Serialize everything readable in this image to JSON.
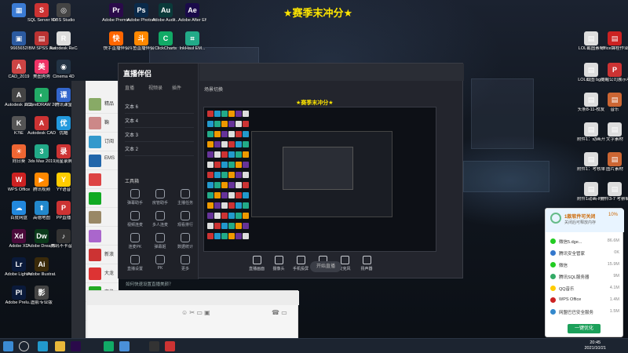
{
  "banner": "★赛季末冲分★",
  "desktop_icons": [
    {
      "label": "",
      "color": "#3b7bd4",
      "glyph": "▦"
    },
    {
      "label": "SQL Server Manage...",
      "color": "#c33",
      "glyph": "S"
    },
    {
      "label": "OBS Studio",
      "color": "#444",
      "glyph": "◎"
    },
    {
      "label": "Adobe Premie...",
      "color": "#2a0a4a",
      "glyph": "Pr"
    },
    {
      "label": "Adobe Photosh...",
      "color": "#0a2a4a",
      "glyph": "Ps"
    },
    {
      "label": "Adobe Audit...",
      "color": "#0a3a3a",
      "glyph": "Au"
    },
    {
      "label": "Adobe After Effects CC ...",
      "color": "#1a0a4a",
      "glyph": "Ae"
    },
    {
      "label": "9665652",
      "color": "#2b5aa0",
      "glyph": "▣"
    },
    {
      "label": "IBM SPSS Statistics 21",
      "color": "#b33",
      "glyph": "▤"
    },
    {
      "label": "Autodesk ReCap",
      "color": "#ddd",
      "glyph": "R"
    },
    {
      "label": "快手直播伴侣",
      "color": "#f60",
      "glyph": "快"
    },
    {
      "label": "斗鱼直播伴侣",
      "color": "#f80",
      "glyph": "斗"
    },
    {
      "label": "ClickCharts",
      "color": "#1a6",
      "glyph": "C"
    },
    {
      "label": "InkHaul EM...",
      "color": "#2a8",
      "glyph": "⌗"
    },
    {
      "label": "CAD_2019",
      "color": "#c44",
      "glyph": "A"
    },
    {
      "label": "美图秀秀",
      "color": "#e36",
      "glyph": "美"
    },
    {
      "label": "Cinema 4D",
      "color": "#234",
      "glyph": "◉"
    },
    {
      "label": "Autodesk 面试用地",
      "color": "#444",
      "glyph": "A"
    },
    {
      "label": "CorelDRAW 2020 (64...)",
      "color": "#2a6",
      "glyph": "◐"
    },
    {
      "label": "腾讯课堂",
      "color": "#36c",
      "glyph": "课"
    },
    {
      "label": "K7tE",
      "color": "#555",
      "glyph": "K"
    },
    {
      "label": "Autodesk CAD 2019 - 简...",
      "color": "#c33",
      "glyph": "A"
    },
    {
      "label": "优酷",
      "color": "#29d",
      "glyph": "优"
    },
    {
      "label": "向日葵",
      "color": "#e63",
      "glyph": "☀"
    },
    {
      "label": "3ds Max 2019",
      "color": "#2a8",
      "glyph": "3"
    },
    {
      "label": "流星录屏",
      "color": "#c33",
      "glyph": "录"
    },
    {
      "label": "WPS Office",
      "color": "#c22",
      "glyph": "W"
    },
    {
      "label": "腾讯视频",
      "color": "#f80",
      "glyph": "▶"
    },
    {
      "label": "YY语音",
      "color": "#fc0",
      "glyph": "Y"
    },
    {
      "label": "百度网盘",
      "color": "#28d",
      "glyph": "☁"
    },
    {
      "label": "高德地图",
      "color": "#28c",
      "glyph": "⬆"
    },
    {
      "label": "PP直播",
      "color": "#c33",
      "glyph": "P"
    },
    {
      "label": "Adobe XD",
      "color": "#4a0a3a",
      "glyph": "Xd"
    },
    {
      "label": "Adobe Dreamwe...",
      "color": "#0a3a1a",
      "glyph": "Dw"
    },
    {
      "label": "腾讯不卡音箱",
      "color": "#333",
      "glyph": "♪"
    },
    {
      "label": "Adobe Lightro...",
      "color": "#0a1a3a",
      "glyph": "Lr"
    },
    {
      "label": "Adobe Illustrat...",
      "color": "#3a2a0a",
      "glyph": "Ai"
    },
    {
      "label": "Adobe Prelu...",
      "color": "#0a1a3a",
      "glyph": "Pl"
    },
    {
      "label": "图影专业版",
      "color": "#444",
      "glyph": "影"
    },
    {
      "label": "LOL截图素材",
      "color": "#ddd",
      "glyph": "▤"
    },
    {
      "label": "office課程作业",
      "color": "#c22",
      "glyph": "▤"
    },
    {
      "label": "LOL截图 bgm",
      "color": "#ddd",
      "glyph": "▤"
    },
    {
      "label": "提醒公司展示项目分享PPT",
      "color": "#c33",
      "glyph": "P"
    },
    {
      "label": "头条8-11-校友",
      "color": "#ddd",
      "glyph": "▤"
    },
    {
      "label": "音乐",
      "color": "#c63",
      "glyph": "▤"
    },
    {
      "label": "附件1：动画开发作",
      "color": "#ddd",
      "glyph": "▤"
    },
    {
      "label": "文字素材",
      "color": "#ddd",
      "glyph": "▤"
    },
    {
      "label": "附件1：考核单+记...",
      "color": "#ddd",
      "glyph": "▤"
    },
    {
      "label": "图片素材",
      "color": "#c63",
      "glyph": "▤"
    },
    {
      "label": "附件1动画-时代...",
      "color": "#ddd",
      "glyph": "▤"
    },
    {
      "label": "附件3-7 考察制作学...",
      "color": "#ddd",
      "glyph": "▤"
    }
  ],
  "contacts": [
    {
      "name": "精品",
      "color": "#8a6"
    },
    {
      "name": "鞠",
      "color": "#c88"
    },
    {
      "name": "订阅",
      "color": "#39c"
    },
    {
      "name": "EMS",
      "color": "#26a"
    },
    {
      "name": "",
      "color": "#d44"
    },
    {
      "name": "",
      "color": "#1a2"
    },
    {
      "name": "",
      "color": "#986"
    },
    {
      "name": "",
      "color": "#a6c"
    },
    {
      "name": "新浪",
      "color": "#c33"
    },
    {
      "name": "大龙",
      "color": "#d33"
    },
    {
      "name": "交换",
      "color": "#2a2"
    },
    {
      "name": "W",
      "color": "#bbb"
    },
    {
      "name": "泥巴",
      "color": "#c44"
    }
  ],
  "live": {
    "logo": "直播伴侣",
    "tabs": [
      "直播",
      "视频录",
      "插件"
    ],
    "side_items": [
      "文本 6",
      "文本 4",
      "文本 3",
      "文本 2"
    ],
    "tools_title": "工具箱",
    "tools": [
      "弹幕助手",
      "房管助手",
      "主播任务",
      "视频连麦",
      "多人连麦",
      "观看排行",
      "连麦PK",
      "弹幕姬",
      "数据统计",
      "直播设置",
      "PK",
      "更多"
    ],
    "title_text": "场景切换",
    "preview_banner": "★赛季末冲分★",
    "bottom_tools": [
      "直播画面",
      "摄像头",
      "手机投屏",
      "多媒体",
      "麦克风",
      "扬声器"
    ],
    "start_label": "开始直播",
    "footer_hint": "如何快速设置直播美颜？"
  },
  "security": {
    "title": "1款软件可关闭",
    "subtitle": "关闭后可释放内存",
    "percent": "10%",
    "items": [
      {
        "name": "微信5.dge...",
        "value": "86.6M",
        "color": "#2c2"
      },
      {
        "name": "腾讯安全管家",
        "value": "0K",
        "color": "#37c"
      },
      {
        "name": "微信",
        "value": "15.9M",
        "color": "#2c2"
      },
      {
        "name": "腾讯SQL服务器",
        "value": "9M",
        "color": "#3a6"
      },
      {
        "name": "QQ音乐",
        "value": "4.1M",
        "color": "#fc0"
      },
      {
        "name": "WPS Office",
        "value": "1.4M",
        "color": "#c22"
      },
      {
        "name": "网盟巴巴安全服务",
        "value": "1.5M",
        "color": "#38c"
      }
    ],
    "button": "一键优化"
  },
  "taskbar": {
    "time": "20:45",
    "date": "2021/10/21"
  }
}
